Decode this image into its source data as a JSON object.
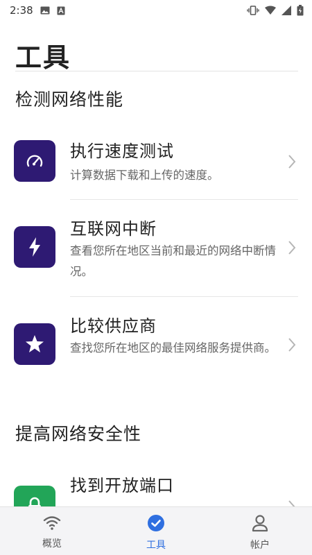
{
  "status_bar": {
    "time": "2:38"
  },
  "header": {
    "title": "工具"
  },
  "sections": [
    {
      "title": "检测网络性能",
      "items": [
        {
          "title": "执行速度测试",
          "desc": "计算数据下载和上传的速度。",
          "icon": "speedometer-icon"
        },
        {
          "title": "互联网中断",
          "desc": "查看您所在地区当前和最近的网络中断情况。",
          "icon": "lightning-icon"
        },
        {
          "title": "比较供应商",
          "desc": "查找您所在地区的最佳网络服务提供商。",
          "icon": "star-icon"
        }
      ]
    },
    {
      "title": "提高网络安全性",
      "items": [
        {
          "title": "找到开放端口",
          "desc": "",
          "icon": "lock-icon"
        }
      ]
    }
  ],
  "bottom_nav": {
    "items": [
      {
        "label": "概览",
        "icon": "wifi-icon",
        "active": false
      },
      {
        "label": "工具",
        "icon": "check-circle-icon",
        "active": true
      },
      {
        "label": "帐户",
        "icon": "person-icon",
        "active": false
      }
    ]
  },
  "colors": {
    "icon_bg": "#2e1a73",
    "icon_bg_secure": "#22a558",
    "accent": "#2f6fe0"
  }
}
